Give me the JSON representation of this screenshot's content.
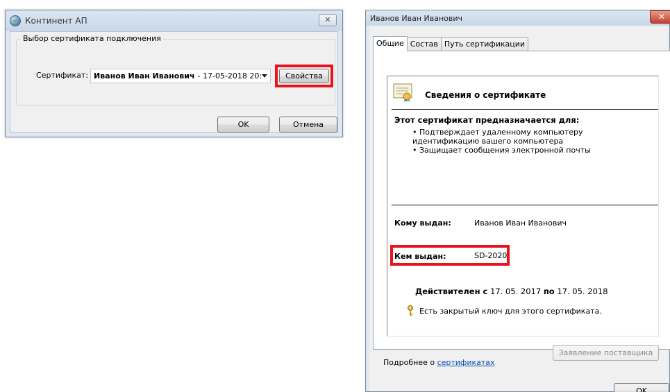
{
  "left_window": {
    "title": "Континент АП",
    "close_glyph": "✕",
    "group_title": "Выбор сертификата подключения",
    "cert_label": "Сертификат:",
    "cert_name": "Иванов Иван Иванович",
    "cert_suffix": "- 17-05-2018 20:",
    "properties_button": "Свойства",
    "ok_button": "OK",
    "cancel_button": "Отмена"
  },
  "right_window": {
    "title": "Иванов Иван Иванович",
    "close_glyph": "✕",
    "tabs": [
      "Общие",
      "Состав",
      "Путь сертификации"
    ],
    "active_tab": 0,
    "cert_info_title": "Сведения о сертификате",
    "purpose_heading": "Этот сертификат предназначается для:",
    "purposes": [
      "• Подтверждает удаленному компьютеру идентификацию вашего компьютера",
      "• Защищает сообщения электронной почты"
    ],
    "issued_to_label": "Кому выдан:",
    "issued_to_value": "Иванов Иван Иванович",
    "issued_by_label": "Кем выдан:",
    "issued_by_value": "SD-2020",
    "valid_from_label": "Действителен с",
    "valid_from": "17. 05. 2017",
    "valid_to_label": "по",
    "valid_to": "17. 05. 2018",
    "private_key_note": "Есть закрытый ключ для этого сертификата.",
    "issuer_statement_button": "Заявление поставщика",
    "more_prefix": "Подробнее о",
    "more_link": "сертификатах",
    "ok_button": "OK"
  },
  "colors": {
    "highlight": "#e8141c",
    "link": "#0b4db5",
    "close_button": "#c4402c"
  },
  "icons": [
    "app-globe-icon",
    "close-icon",
    "dropdown-arrow-icon",
    "certificate-icon",
    "key-icon"
  ]
}
